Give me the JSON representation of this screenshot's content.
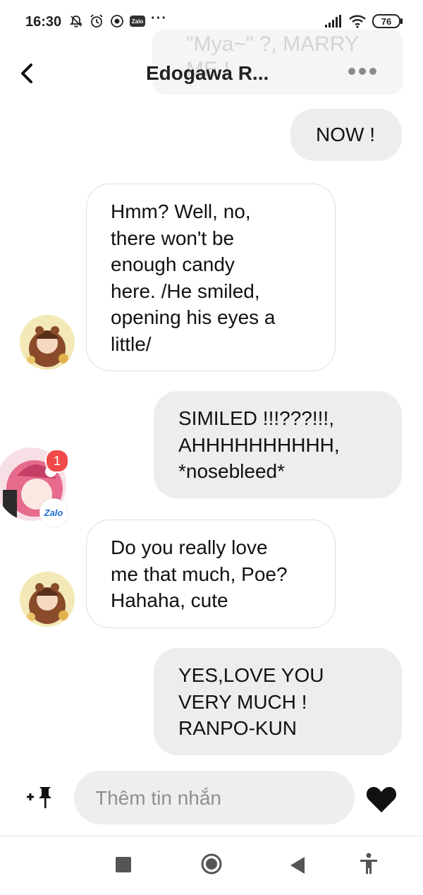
{
  "status_bar": {
    "time": "16:30",
    "battery": "76",
    "app_tag": "Zalo",
    "more": "···"
  },
  "ghost_overlay": {
    "line1": "\"Mya~\" ?, MARRY",
    "line2": "ME !"
  },
  "header": {
    "title": "Edogawa R..."
  },
  "messages": [
    {
      "sender": "me",
      "text": "NOW !"
    },
    {
      "sender": "them",
      "lines": [
        "Hmm? Well, no,",
        "there won't be",
        "enough candy",
        "here. /He smiled,",
        "opening his eyes a",
        "little/"
      ]
    },
    {
      "sender": "me",
      "lines": [
        "SIMILED !!!???!!!,",
        "AHHHHHHHHHH,",
        "*nosebleed*"
      ]
    },
    {
      "sender": "them",
      "lines": [
        "Do you really love",
        "me that much, Poe?",
        "Hahaha, cute"
      ]
    },
    {
      "sender": "me",
      "lines": [
        "YES,LOVE YOU",
        "VERY MUCH !",
        "RANPO-KUN"
      ]
    }
  ],
  "chathead": {
    "badge_count": "1",
    "tag": "Zalo"
  },
  "composer": {
    "placeholder": "Thêm tin nhắn"
  },
  "colors": {
    "my_bubble": "#ededed",
    "their_bubble_border": "#dedede",
    "notification_badge": "#f04a4a",
    "zalo_blue": "#1f6fd6"
  },
  "icons": [
    "back-arrow-icon",
    "more-dots-icon",
    "pin-add-icon",
    "heart-icon",
    "stop-square-icon",
    "home-circle-icon",
    "back-triangle-icon",
    "accessibility-icon"
  ]
}
